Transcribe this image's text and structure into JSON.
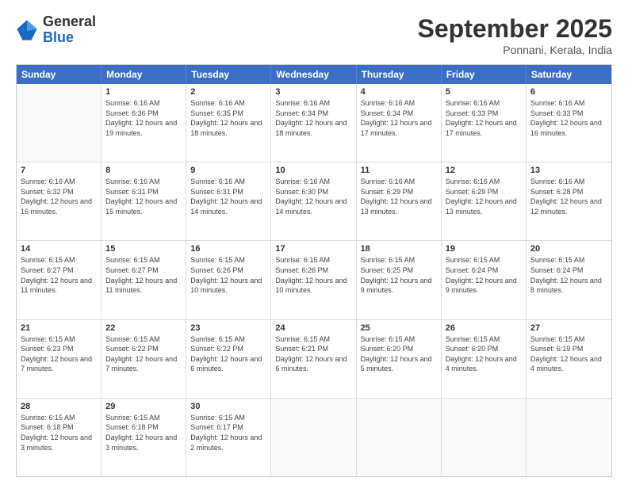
{
  "logo": {
    "line1": "General",
    "line2": "Blue"
  },
  "title": "September 2025",
  "location": "Ponnani, Kerala, India",
  "days_of_week": [
    "Sunday",
    "Monday",
    "Tuesday",
    "Wednesday",
    "Thursday",
    "Friday",
    "Saturday"
  ],
  "weeks": [
    [
      {
        "day": "",
        "empty": true
      },
      {
        "day": "1",
        "sunrise": "Sunrise: 6:16 AM",
        "sunset": "Sunset: 6:36 PM",
        "daylight": "Daylight: 12 hours and 19 minutes."
      },
      {
        "day": "2",
        "sunrise": "Sunrise: 6:16 AM",
        "sunset": "Sunset: 6:35 PM",
        "daylight": "Daylight: 12 hours and 18 minutes."
      },
      {
        "day": "3",
        "sunrise": "Sunrise: 6:16 AM",
        "sunset": "Sunset: 6:34 PM",
        "daylight": "Daylight: 12 hours and 18 minutes."
      },
      {
        "day": "4",
        "sunrise": "Sunrise: 6:16 AM",
        "sunset": "Sunset: 6:34 PM",
        "daylight": "Daylight: 12 hours and 17 minutes."
      },
      {
        "day": "5",
        "sunrise": "Sunrise: 6:16 AM",
        "sunset": "Sunset: 6:33 PM",
        "daylight": "Daylight: 12 hours and 17 minutes."
      },
      {
        "day": "6",
        "sunrise": "Sunrise: 6:16 AM",
        "sunset": "Sunset: 6:33 PM",
        "daylight": "Daylight: 12 hours and 16 minutes."
      }
    ],
    [
      {
        "day": "7",
        "sunrise": "Sunrise: 6:16 AM",
        "sunset": "Sunset: 6:32 PM",
        "daylight": "Daylight: 12 hours and 16 minutes."
      },
      {
        "day": "8",
        "sunrise": "Sunrise: 6:16 AM",
        "sunset": "Sunset: 6:31 PM",
        "daylight": "Daylight: 12 hours and 15 minutes."
      },
      {
        "day": "9",
        "sunrise": "Sunrise: 6:16 AM",
        "sunset": "Sunset: 6:31 PM",
        "daylight": "Daylight: 12 hours and 14 minutes."
      },
      {
        "day": "10",
        "sunrise": "Sunrise: 6:16 AM",
        "sunset": "Sunset: 6:30 PM",
        "daylight": "Daylight: 12 hours and 14 minutes."
      },
      {
        "day": "11",
        "sunrise": "Sunrise: 6:16 AM",
        "sunset": "Sunset: 6:29 PM",
        "daylight": "Daylight: 12 hours and 13 minutes."
      },
      {
        "day": "12",
        "sunrise": "Sunrise: 6:16 AM",
        "sunset": "Sunset: 6:29 PM",
        "daylight": "Daylight: 12 hours and 13 minutes."
      },
      {
        "day": "13",
        "sunrise": "Sunrise: 6:16 AM",
        "sunset": "Sunset: 6:28 PM",
        "daylight": "Daylight: 12 hours and 12 minutes."
      }
    ],
    [
      {
        "day": "14",
        "sunrise": "Sunrise: 6:15 AM",
        "sunset": "Sunset: 6:27 PM",
        "daylight": "Daylight: 12 hours and 11 minutes."
      },
      {
        "day": "15",
        "sunrise": "Sunrise: 6:15 AM",
        "sunset": "Sunset: 6:27 PM",
        "daylight": "Daylight: 12 hours and 11 minutes."
      },
      {
        "day": "16",
        "sunrise": "Sunrise: 6:15 AM",
        "sunset": "Sunset: 6:26 PM",
        "daylight": "Daylight: 12 hours and 10 minutes."
      },
      {
        "day": "17",
        "sunrise": "Sunrise: 6:15 AM",
        "sunset": "Sunset: 6:26 PM",
        "daylight": "Daylight: 12 hours and 10 minutes."
      },
      {
        "day": "18",
        "sunrise": "Sunrise: 6:15 AM",
        "sunset": "Sunset: 6:25 PM",
        "daylight": "Daylight: 12 hours and 9 minutes."
      },
      {
        "day": "19",
        "sunrise": "Sunrise: 6:15 AM",
        "sunset": "Sunset: 6:24 PM",
        "daylight": "Daylight: 12 hours and 9 minutes."
      },
      {
        "day": "20",
        "sunrise": "Sunrise: 6:15 AM",
        "sunset": "Sunset: 6:24 PM",
        "daylight": "Daylight: 12 hours and 8 minutes."
      }
    ],
    [
      {
        "day": "21",
        "sunrise": "Sunrise: 6:15 AM",
        "sunset": "Sunset: 6:23 PM",
        "daylight": "Daylight: 12 hours and 7 minutes."
      },
      {
        "day": "22",
        "sunrise": "Sunrise: 6:15 AM",
        "sunset": "Sunset: 6:22 PM",
        "daylight": "Daylight: 12 hours and 7 minutes."
      },
      {
        "day": "23",
        "sunrise": "Sunrise: 6:15 AM",
        "sunset": "Sunset: 6:22 PM",
        "daylight": "Daylight: 12 hours and 6 minutes."
      },
      {
        "day": "24",
        "sunrise": "Sunrise: 6:15 AM",
        "sunset": "Sunset: 6:21 PM",
        "daylight": "Daylight: 12 hours and 6 minutes."
      },
      {
        "day": "25",
        "sunrise": "Sunrise: 6:15 AM",
        "sunset": "Sunset: 6:20 PM",
        "daylight": "Daylight: 12 hours and 5 minutes."
      },
      {
        "day": "26",
        "sunrise": "Sunrise: 6:15 AM",
        "sunset": "Sunset: 6:20 PM",
        "daylight": "Daylight: 12 hours and 4 minutes."
      },
      {
        "day": "27",
        "sunrise": "Sunrise: 6:15 AM",
        "sunset": "Sunset: 6:19 PM",
        "daylight": "Daylight: 12 hours and 4 minutes."
      }
    ],
    [
      {
        "day": "28",
        "sunrise": "Sunrise: 6:15 AM",
        "sunset": "Sunset: 6:18 PM",
        "daylight": "Daylight: 12 hours and 3 minutes."
      },
      {
        "day": "29",
        "sunrise": "Sunrise: 6:15 AM",
        "sunset": "Sunset: 6:18 PM",
        "daylight": "Daylight: 12 hours and 3 minutes."
      },
      {
        "day": "30",
        "sunrise": "Sunrise: 6:15 AM",
        "sunset": "Sunset: 6:17 PM",
        "daylight": "Daylight: 12 hours and 2 minutes."
      },
      {
        "day": "",
        "empty": true
      },
      {
        "day": "",
        "empty": true
      },
      {
        "day": "",
        "empty": true
      },
      {
        "day": "",
        "empty": true
      }
    ]
  ]
}
